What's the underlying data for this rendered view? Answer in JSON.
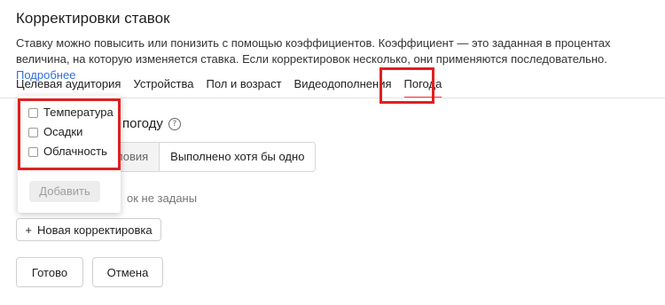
{
  "title": "Корректировки ставок",
  "description": {
    "text": "Ставку можно повысить или понизить с помощью коэффициентов. Коэффициент — это заданная в процентах величина, на которую изменяется ставка. Если корректировок несколько, они применяются последовательно.",
    "link": "Подробнее"
  },
  "tabs": [
    {
      "label": "Целевая аудитория"
    },
    {
      "label": "Устройства"
    },
    {
      "label": "Пол и возраст"
    },
    {
      "label": "Видеодополнения"
    },
    {
      "label": "Погода",
      "active": true
    }
  ],
  "section": {
    "label_visible": "погоду",
    "help_icon": "question-circle-icon"
  },
  "segmented": {
    "left_visible": "ловия",
    "right": "Выполнено хотя бы одно"
  },
  "hint_visible": "ок не заданы",
  "dropdown": {
    "options": [
      {
        "label": "Температура",
        "checked": false
      },
      {
        "label": "Осадки",
        "checked": false
      },
      {
        "label": "Облачность",
        "checked": false
      }
    ],
    "add_button": "Добавить"
  },
  "buttons": {
    "new_adjustment": "Новая корректировка",
    "new_adjustment_icon": "+",
    "done": "Готово",
    "cancel": "Отмена"
  },
  "colors": {
    "accent_red": "#e0201f",
    "link": "#2f6fd6"
  }
}
